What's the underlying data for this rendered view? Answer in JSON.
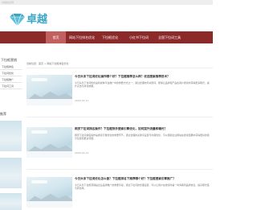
{
  "topbar": {
    "text": "卓越信息网"
  },
  "logo": {
    "text": "卓越"
  },
  "nav": {
    "items": [
      {
        "label": "首页",
        "active": true
      },
      {
        "label": "网站下拉排名优化"
      },
      {
        "label": "下拉框优化"
      },
      {
        "label": "小红书下拉词"
      },
      {
        "label": "全国下拉词工具"
      }
    ]
  },
  "sidebar": {
    "title": "下拉框营销",
    "items": [
      "下拉框排名",
      "下拉词优化",
      "下拉框推广",
      "下拉词工具"
    ],
    "title2": "推荐"
  },
  "breadcrumb": "当前位置：首页 > 网站下拉框排名优化",
  "articles": [
    {
      "title": "今日头条下拉词优化操作哪个好？下拉框推荐怎么样？优选搜索推荐技术？",
      "desc": "今日头条下拉词优化是新媒体平台推广中的重要方式之一，通过合理布局关键词，能够让品牌和产品在用户搜索时获得更多曝光，提升点击与转化效果。",
      "date": "2020-01-11"
    },
    {
      "title": "网页下拉词排名操作？下拉框快手搜索引擎优化，如何提升流量和曝光？",
      "desc": "网页下拉词排名操作是搜索引擎优化的重要环节，通过合理的关键词设置与内容优化，可以帮助企业网站在搜索结果中获得更好的展示位置和更多流量。",
      "date": "2020-01-11"
    },
    {
      "title": "今日头条下拉词优化怎么做？下拉框排名下推荐哪个好？下拉框搜索引擎推广？",
      "desc": "今日头条下拉框营销是企业品牌推广的重要手段，通过下拉词的合理设置，可以让用户在搜索时第一时间看到品牌信息，提高曝光度与转化率。",
      "date": ""
    }
  ]
}
